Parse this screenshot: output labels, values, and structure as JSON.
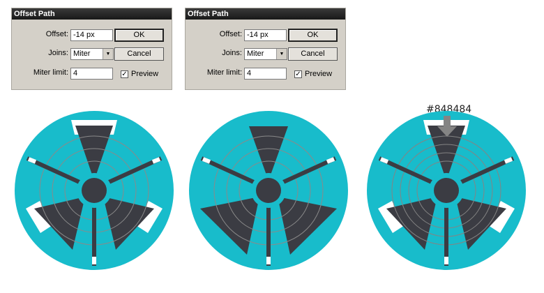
{
  "dialogs": [
    {
      "title": "Offset Path",
      "offset_label": "Offset:",
      "offset_value": "-14 px",
      "joins_label": "Joins:",
      "joins_value": "Miter",
      "miter_label": "Miter limit:",
      "miter_value": "4",
      "ok_label": "OK",
      "cancel_label": "Cancel",
      "preview_label": "Preview",
      "preview_checked": true
    },
    {
      "title": "Offset Path",
      "offset_label": "Offset:",
      "offset_value": "-14 px",
      "joins_label": "Joins:",
      "joins_value": "Miter",
      "miter_label": "Miter limit:",
      "miter_value": "4",
      "ok_label": "OK",
      "cancel_label": "Cancel",
      "preview_label": "Preview",
      "preview_checked": true
    }
  ],
  "annotation": {
    "color_label": "#848484"
  },
  "colors": {
    "teal": "#18bccb",
    "dark_gray": "#3b3c43",
    "white": "#ffffff",
    "guide_gray": "#8a8a8a",
    "arrow": "#848484"
  },
  "icons": {
    "check": "✓",
    "dropdown": "▼"
  }
}
